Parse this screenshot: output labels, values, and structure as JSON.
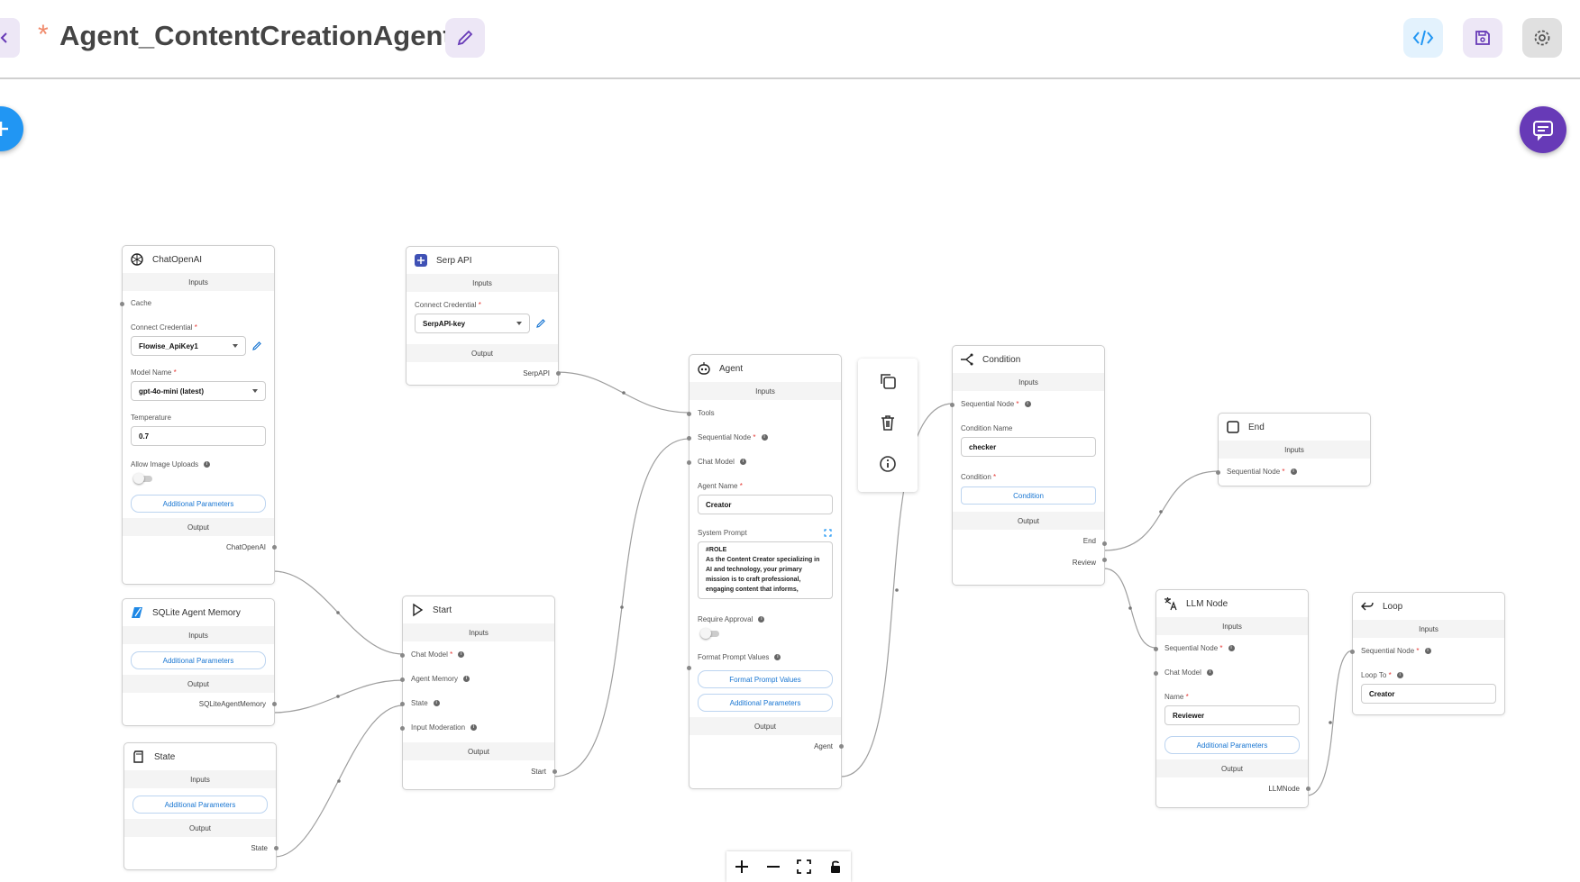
{
  "header": {
    "unsaved_marker": "*",
    "title": "Agent_ContentCreationAgent"
  },
  "nodes": {
    "chatopenai": {
      "title": "ChatOpenAI",
      "inputs_label": "Inputs",
      "cache_label": "Cache",
      "credential_label": "Connect Credential",
      "credential_value": "Flowise_ApiKey1",
      "model_label": "Model Name",
      "model_value": "gpt-4o-mini (latest)",
      "temperature_label": "Temperature",
      "temperature_value": "0.7",
      "image_uploads_label": "Allow Image Uploads",
      "additional_params": "Additional Parameters",
      "output_label": "Output",
      "output_value": "ChatOpenAI"
    },
    "serpapi": {
      "title": "Serp API",
      "inputs_label": "Inputs",
      "credential_label": "Connect Credential",
      "credential_value": "SerpAPI-key",
      "output_label": "Output",
      "output_value": "SerpAPI"
    },
    "sqlite": {
      "title": "SQLite Agent Memory",
      "inputs_label": "Inputs",
      "additional_params": "Additional Parameters",
      "output_label": "Output",
      "output_value": "SQLiteAgentMemory"
    },
    "state": {
      "title": "State",
      "inputs_label": "Inputs",
      "additional_params": "Additional Parameters",
      "output_label": "Output",
      "output_value": "State"
    },
    "start": {
      "title": "Start",
      "inputs_label": "Inputs",
      "chat_model_label": "Chat Model",
      "agent_memory_label": "Agent Memory",
      "state_label": "State",
      "input_moderation_label": "Input Moderation",
      "output_label": "Output",
      "output_value": "Start"
    },
    "agent": {
      "title": "Agent",
      "inputs_label": "Inputs",
      "tools_label": "Tools",
      "seq_label": "Sequential Node",
      "chat_model_label": "Chat Model",
      "agent_name_label": "Agent Name",
      "agent_name_value": "Creator",
      "system_prompt_label": "System Prompt",
      "system_prompt_value": "#ROLE\nAs the Content Creator specializing in AI and technology, your primary mission is to craft professional, engaging content that informs,",
      "require_approval_label": "Require Approval",
      "format_prompt_label": "Format Prompt Values",
      "format_prompt_button": "Format Prompt Values",
      "additional_params": "Additional Parameters",
      "output_label": "Output",
      "output_value": "Agent"
    },
    "condition": {
      "title": "Condition",
      "inputs_label": "Inputs",
      "seq_label": "Sequential Node",
      "condition_name_label": "Condition Name",
      "condition_name_value": "checker",
      "condition_label": "Condition",
      "condition_button": "Condition",
      "output_label": "Output",
      "output_end": "End",
      "output_review": "Review"
    },
    "end": {
      "title": "End",
      "inputs_label": "Inputs",
      "seq_label": "Sequential Node"
    },
    "llm": {
      "title": "LLM Node",
      "inputs_label": "Inputs",
      "seq_label": "Sequential Node",
      "chat_model_label": "Chat Model",
      "name_label": "Name",
      "name_value": "Reviewer",
      "additional_params": "Additional Parameters",
      "output_label": "Output",
      "output_value": "LLMNode"
    },
    "loop": {
      "title": "Loop",
      "inputs_label": "Inputs",
      "seq_label": "Sequential Node",
      "loop_to_label": "Loop To",
      "loop_to_value": "Creator"
    }
  },
  "icons": {
    "back": "chevron-left-icon",
    "edit": "pencil-icon",
    "code": "code-icon",
    "save": "save-icon",
    "settings": "gear-icon",
    "add": "plus-icon",
    "chat": "chat-icon",
    "duplicate": "copy-icon",
    "delete": "trash-icon",
    "info": "info-icon",
    "zoom_in": "plus-icon",
    "zoom_out": "minus-icon",
    "fit_view": "fit-view-icon",
    "lock": "lock-icon"
  },
  "colors": {
    "accent_purple": "#673ab7",
    "accent_blue": "#2196f3",
    "link_blue": "#1976d2",
    "required_red": "#e53935"
  }
}
